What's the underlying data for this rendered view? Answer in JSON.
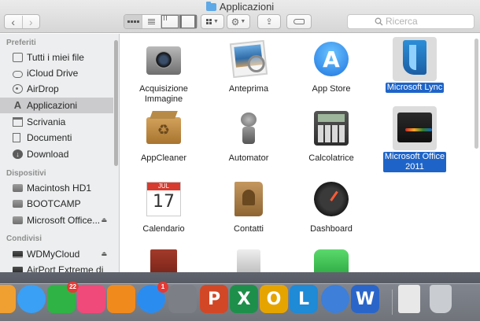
{
  "window": {
    "title": "Applicazioni"
  },
  "toolbar": {
    "back": "‹",
    "forward": "›",
    "search_placeholder": "Ricerca"
  },
  "sidebar": {
    "sections": [
      {
        "label": "Preferiti"
      },
      {
        "label": "Dispositivi"
      },
      {
        "label": "Condivisi"
      }
    ],
    "items": [
      {
        "label": "Tutti i miei file",
        "icon": "all-files-icon"
      },
      {
        "label": "iCloud Drive",
        "icon": "cloud-icon"
      },
      {
        "label": "AirDrop",
        "icon": "airdrop-icon"
      },
      {
        "label": "Applicazioni",
        "icon": "applications-icon",
        "selected": true
      },
      {
        "label": "Scrivania",
        "icon": "desktop-icon"
      },
      {
        "label": "Documenti",
        "icon": "documents-icon"
      },
      {
        "label": "Download",
        "icon": "download-icon"
      },
      {
        "label": "Macintosh HD1",
        "icon": "disk-icon"
      },
      {
        "label": "BOOTCAMP",
        "icon": "disk-icon"
      },
      {
        "label": "Microsoft Office...",
        "icon": "disk-icon",
        "eject": true
      },
      {
        "label": "WDMyCloud",
        "icon": "network-drive-icon",
        "eject": true
      },
      {
        "label": "AirPort Extreme di",
        "icon": "network-drive-icon"
      }
    ]
  },
  "apps": [
    {
      "label": "Acquisizione\nImmagine",
      "icon": "image-capture-icon"
    },
    {
      "label": "Anteprima",
      "icon": "preview-icon"
    },
    {
      "label": "App Store",
      "icon": "app-store-icon"
    },
    {
      "label": "Microsoft Lync",
      "icon": "microsoft-lync-icon",
      "selected": true
    },
    {
      "label": "AppCleaner",
      "icon": "appcleaner-icon"
    },
    {
      "label": "Automator",
      "icon": "automator-icon"
    },
    {
      "label": "Calcolatrice",
      "icon": "calculator-icon"
    },
    {
      "label": "Microsoft Office\n2011",
      "icon": "microsoft-office-folder-icon",
      "selected": true
    },
    {
      "label": "Calendario",
      "icon": "calendar-icon"
    },
    {
      "label": "Contatti",
      "icon": "contacts-icon"
    },
    {
      "label": "Dashboard",
      "icon": "dashboard-icon"
    },
    {
      "label": "",
      "icon": "dictionary-icon"
    },
    {
      "label": "",
      "icon": "dvd-player-icon"
    },
    {
      "label": "",
      "icon": "facetime-icon"
    }
  ],
  "dock": {
    "items": [
      {
        "icon": "photos-icon",
        "color": "#f0a030"
      },
      {
        "icon": "messages-icon",
        "color": "#3aa0f5"
      },
      {
        "icon": "facetime-icon",
        "color": "#2fb344",
        "badge": "22"
      },
      {
        "icon": "itunes-icon",
        "color": "#ef4a7a"
      },
      {
        "icon": "ibooks-icon",
        "color": "#f08a1c"
      },
      {
        "icon": "app-store-icon",
        "color": "#2b8cf0",
        "badge": "1"
      },
      {
        "icon": "system-preferences-icon",
        "color": "#7d7f86"
      },
      {
        "icon": "powerpoint-icon",
        "color": "#d24726",
        "glyph": "P"
      },
      {
        "icon": "excel-icon",
        "color": "#1e8f4a",
        "glyph": "X"
      },
      {
        "icon": "outlook-icon",
        "color": "#e6a400",
        "glyph": "O"
      },
      {
        "icon": "lync-icon",
        "color": "#1f8ad6",
        "glyph": "L"
      },
      {
        "icon": "downloader-icon",
        "color": "#3d7fd9"
      },
      {
        "icon": "word-icon",
        "color": "#2a66c9",
        "glyph": "W"
      },
      {
        "icon": "documents-stack-icon",
        "color": "#e8e8e8"
      },
      {
        "icon": "trash-icon",
        "color": "#c9ccd1"
      }
    ]
  }
}
